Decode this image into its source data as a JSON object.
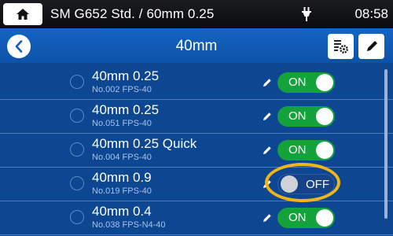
{
  "statusbar": {
    "title": "SM G652 Std. / 60mm 0.25",
    "time": "08:58",
    "home_icon": "home-icon",
    "power_icon": "plug-icon"
  },
  "header": {
    "title": "40mm",
    "back_icon": "chevron-left-icon",
    "settings_icon": "list-settings-icon",
    "edit_icon": "pencil-icon"
  },
  "list": {
    "items": [
      {
        "name": "40mm 0.25",
        "sub": "No.002 FPS-40",
        "toggle": "ON",
        "state": "on"
      },
      {
        "name": "40mm 0.25",
        "sub": "No.051 FPS-40",
        "toggle": "ON",
        "state": "on"
      },
      {
        "name": "40mm 0.25 Quick",
        "sub": "No.004 FPS-40",
        "toggle": "ON",
        "state": "on"
      },
      {
        "name": "40mm 0.9",
        "sub": "No.019 FPS-40",
        "toggle": "OFF",
        "state": "off"
      },
      {
        "name": "40mm 0.4",
        "sub": "No.038 FPS-N4-40",
        "toggle": "ON",
        "state": "on"
      }
    ]
  },
  "colors": {
    "background": "#0d4792",
    "toggle_on": "#13a33a",
    "highlight": "#f2b418"
  }
}
